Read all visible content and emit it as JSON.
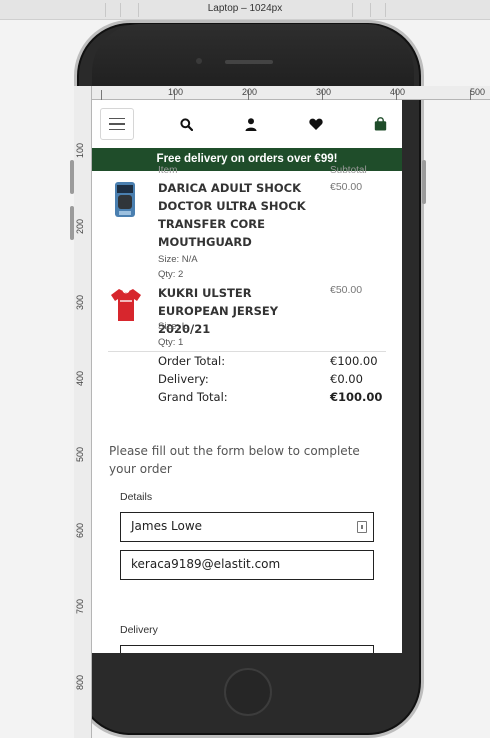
{
  "toolbar": {
    "device_label": "Laptop – 1024px"
  },
  "ruler": {
    "h_labels": [
      "100",
      "200",
      "300",
      "400",
      "500"
    ],
    "v_labels": [
      "100",
      "200",
      "300",
      "400",
      "500",
      "600",
      "700",
      "800"
    ]
  },
  "navbar": {
    "menu_icon": "hamburger-icon",
    "icons": [
      "search-icon",
      "user-icon",
      "heart-icon",
      "shopping-bag-icon"
    ]
  },
  "banner": {
    "text": "Free delivery on orders over €99!"
  },
  "order": {
    "col_item": "Item",
    "col_subtotal": "Subtotal",
    "items": [
      {
        "name": "DARICA ADULT SHOCK DOCTOR ULTRA SHOCK TRANSFER CORE MOUTHGUARD",
        "size": "Size: N/A",
        "qty": "Qty: 2",
        "price": "€50.00"
      },
      {
        "name": "KUKRI ULSTER EUROPEAN JERSEY 2020/21",
        "size": "Size: L",
        "qty": "Qty: 1",
        "price": "€50.00"
      }
    ],
    "totals": {
      "order_total_label": "Order Total:",
      "order_total": "€100.00",
      "delivery_label": "Delivery:",
      "delivery": "€0.00",
      "grand_total_label": "Grand Total:",
      "grand_total": "€100.00"
    }
  },
  "form": {
    "intro": "Please fill out the form below to complete your order",
    "details_legend": "Details",
    "full_name_value": "James Lowe",
    "email_value": "keraca9189@elastit.com",
    "delivery_legend": "Delivery"
  },
  "colors": {
    "banner": "#1f4d2a",
    "item_price": "#777777",
    "jersey": "#d7262d"
  }
}
